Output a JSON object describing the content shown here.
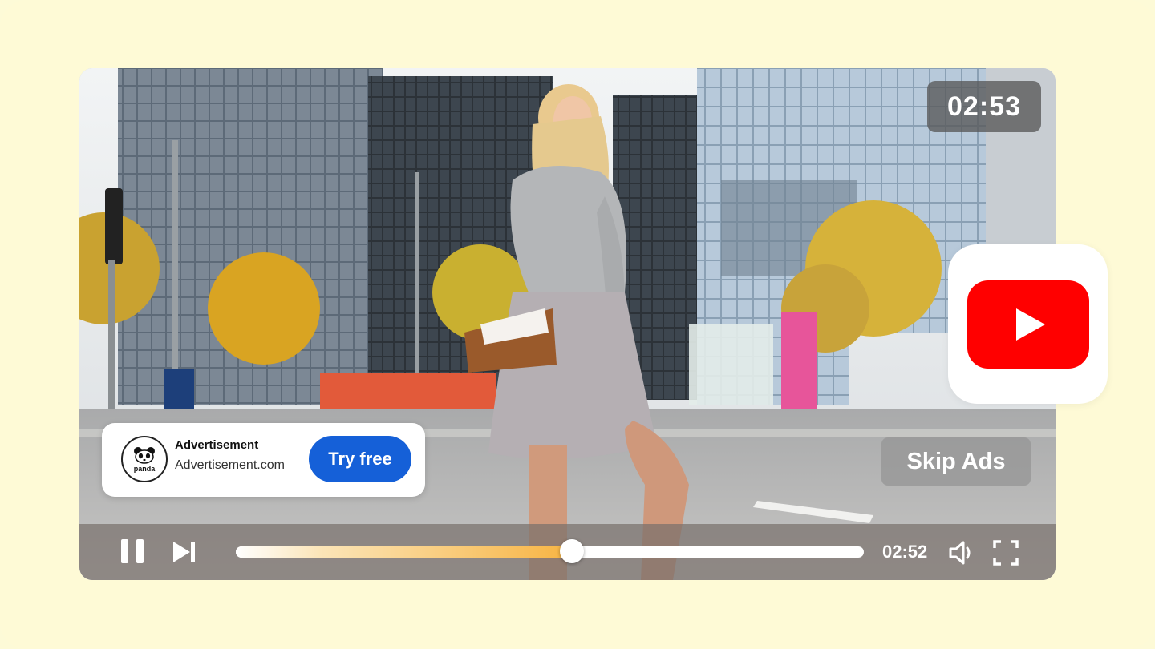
{
  "player": {
    "elapsed_badge": "02:53",
    "current_time": "02:52",
    "progress": 0.535,
    "skip_label": "Skip Ads"
  },
  "ad": {
    "brand": "panda",
    "title": "Advertisement",
    "url": "Advertisement.com",
    "cta": "Try free"
  },
  "icons": {
    "pause": "pause-icon",
    "next": "skip-next-icon",
    "volume": "volume-icon",
    "fullscreen": "fullscreen-icon",
    "logo": "youtube-logo-icon"
  },
  "colors": {
    "background": "#fefad6",
    "cta": "#1560d8",
    "progress_accent": "#f7b443",
    "youtube_red": "#ff0000"
  }
}
